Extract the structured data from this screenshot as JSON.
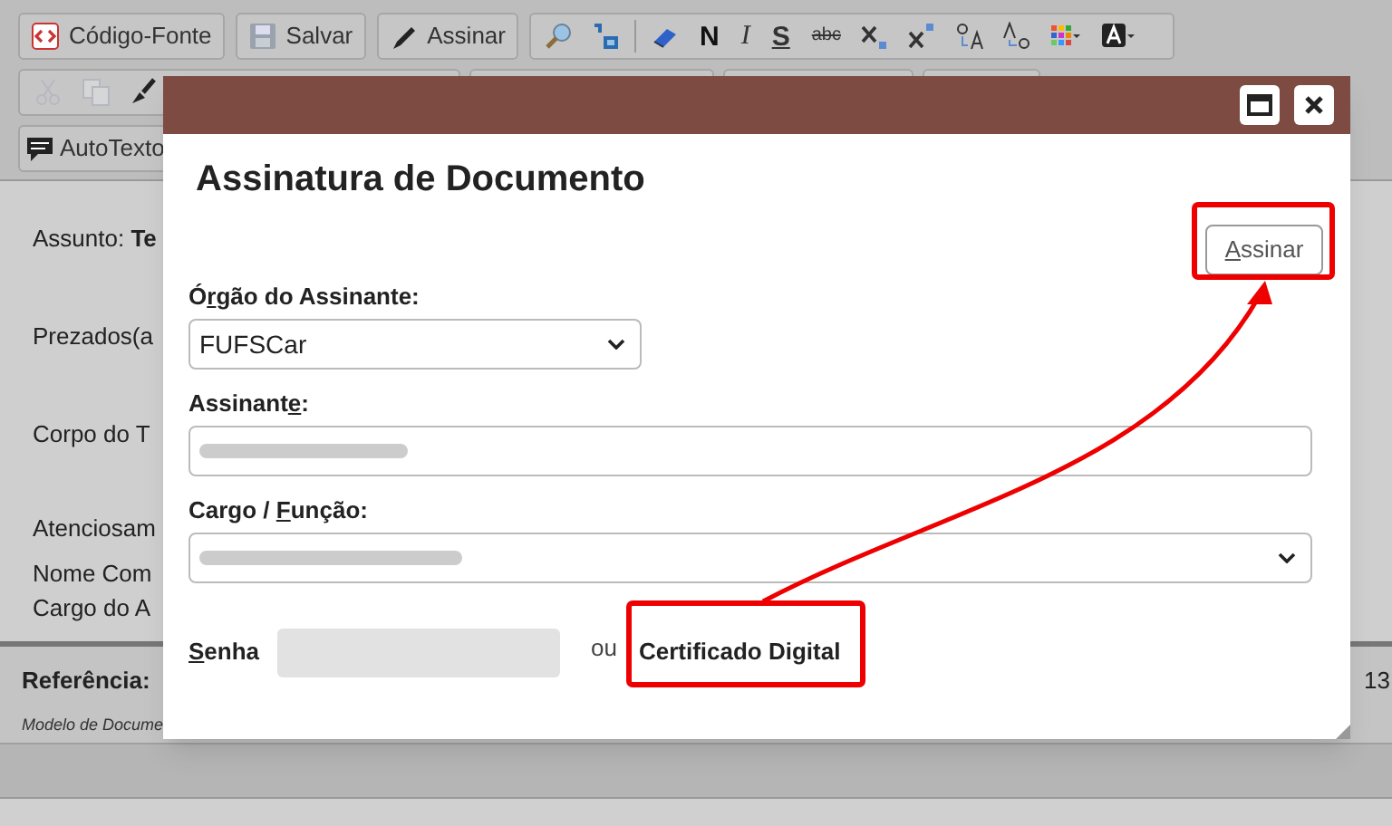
{
  "toolbar": {
    "row1_buttons": [
      {
        "kind": "source",
        "label": "Código-Fonte"
      },
      {
        "kind": "save",
        "label": "Salvar"
      },
      {
        "kind": "sign",
        "label": "Assinar"
      }
    ],
    "format_tools": [
      {
        "kind": "find"
      },
      {
        "kind": "replace"
      },
      {
        "kind": "eraser"
      },
      {
        "kind": "bold",
        "label": "N"
      },
      {
        "kind": "italic",
        "label": "I"
      },
      {
        "kind": "underline",
        "label": "S"
      },
      {
        "kind": "strike",
        "label": "abc"
      },
      {
        "kind": "sub"
      },
      {
        "kind": "sup"
      },
      {
        "kind": "lower"
      },
      {
        "kind": "upper"
      },
      {
        "kind": "color_grid"
      },
      {
        "kind": "text_color"
      }
    ],
    "row2_tools": [
      {
        "kind": "cut",
        "disabled": true
      },
      {
        "kind": "copy",
        "disabled": true
      },
      {
        "kind": "brush",
        "disabled": false
      }
    ],
    "row3_buttons": [
      {
        "kind": "autotext",
        "label": "AutoTexto"
      }
    ]
  },
  "document": {
    "lines": [
      {
        "label": "Assunto:",
        "bold_part": "Te"
      },
      {
        "text": "Prezados(a"
      },
      {
        "text": "Corpo do T"
      },
      {
        "text": "Atenciosam"
      },
      {
        "text": "Nome Com"
      },
      {
        "text": "Cargo do A"
      }
    ],
    "footer": {
      "reference_label": "Referência:",
      "right_text": "13",
      "model_text": "Modelo de Docume"
    }
  },
  "dialog": {
    "title": "Assinatura de Documento",
    "sign_button": {
      "label": {
        "key": "A",
        "after": "ssinar"
      }
    },
    "fields": [
      {
        "kind": "select",
        "label": {
          "before": "Ó",
          "key": "r",
          "after": "gão do Assinante:"
        },
        "value": "FUFSCar"
      },
      {
        "kind": "text",
        "label": {
          "before": "Assinant",
          "key": "e",
          "after": ":"
        },
        "value_redacted": true
      },
      {
        "kind": "select",
        "label": {
          "before": "Cargo / ",
          "key": "F",
          "after": "unção:"
        },
        "value_redacted": true
      }
    ],
    "password": {
      "label": {
        "key": "S",
        "after": "enha"
      },
      "disabled": true
    },
    "or_text": "ou",
    "certificate_label": "Certificado Digital"
  }
}
